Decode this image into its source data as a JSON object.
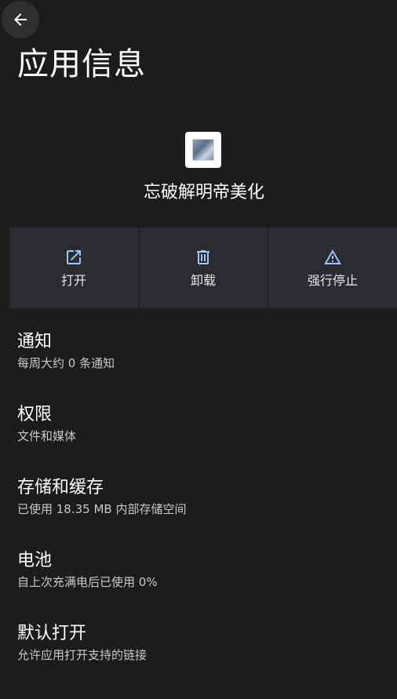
{
  "header": {
    "back_icon": "arrow-back-icon",
    "title": "应用信息"
  },
  "app": {
    "icon": "app-thumbnail-icon",
    "name": "忘破解明帝美化"
  },
  "actions": [
    {
      "label": "打开",
      "icon": "open-external-icon"
    },
    {
      "label": "卸载",
      "icon": "trash-icon"
    },
    {
      "label": "强行停止",
      "icon": "warning-icon"
    }
  ],
  "settings": [
    {
      "title": "通知",
      "subtitle": "每周大约 0 条通知"
    },
    {
      "title": "权限",
      "subtitle": "文件和媒体"
    },
    {
      "title": "存储和缓存",
      "subtitle": "已使用 18.35 MB 内部存储空间"
    },
    {
      "title": "电池",
      "subtitle": "自上次充满电后已使用 0%"
    },
    {
      "title": "默认打开",
      "subtitle": "允许应用打开支持的链接"
    }
  ],
  "colors": {
    "background": "#1c1c1c",
    "card": "#2b2c2f",
    "text": "#ffffff",
    "secondary_text": "#c9c9c9"
  }
}
